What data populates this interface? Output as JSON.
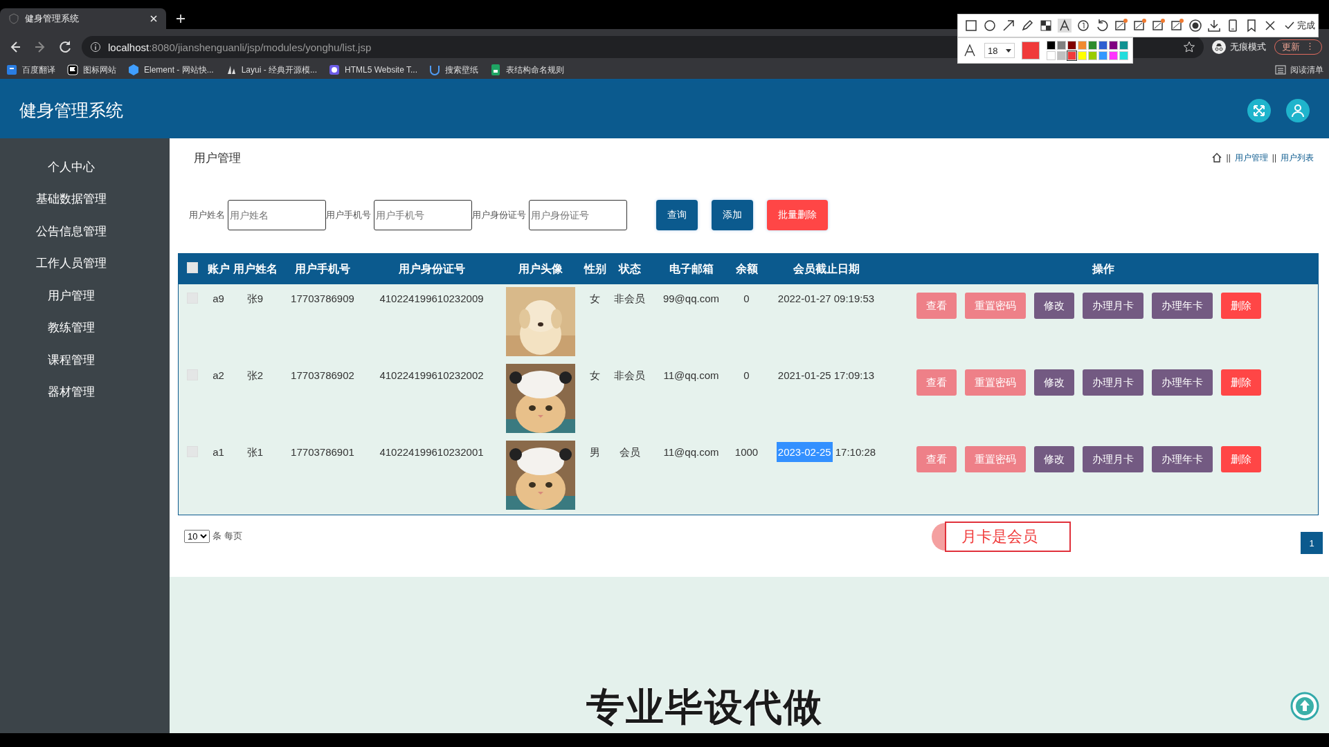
{
  "browser": {
    "tab_title": "健身管理系统",
    "url_host": "localhost",
    "url_path": ":8080/jianshenguanli/jsp/modules/yonghu/list.jsp",
    "incognito": "无痕模式",
    "update": "更新",
    "update_menu": "⋮",
    "reading_list": "阅读清单",
    "bookmarks": [
      {
        "label": "百度翻译",
        "kind": "translate"
      },
      {
        "label": "图标网站",
        "kind": "flag"
      },
      {
        "label": "Element - 网站快...",
        "kind": "hex"
      },
      {
        "label": "Layui - 经典开源模...",
        "kind": "layui"
      },
      {
        "label": "HTML5 Website T...",
        "kind": "mask"
      },
      {
        "label": "搜索壁纸",
        "kind": "u"
      },
      {
        "label": "表结构命名规则",
        "kind": "sheet"
      }
    ]
  },
  "snip_toolbar": {
    "done": "完成",
    "font_size": "18",
    "palette": [
      {
        "color": "#000000",
        "selected": false
      },
      {
        "color": "#808080",
        "selected": false
      },
      {
        "color": "#800000",
        "selected": false
      },
      {
        "color": "#f08a30",
        "selected": false
      },
      {
        "color": "#2e8b2e",
        "selected": false
      },
      {
        "color": "#2f5fd0",
        "selected": false
      },
      {
        "color": "#800080",
        "selected": false
      },
      {
        "color": "#109090",
        "selected": false
      },
      {
        "color": "#ffffff",
        "selected": false
      },
      {
        "color": "#c0c0c0",
        "selected": false
      },
      {
        "color": "#f03a3a",
        "selected": true
      },
      {
        "color": "#ffff00",
        "selected": false
      },
      {
        "color": "#99cc00",
        "selected": false
      },
      {
        "color": "#3399ff",
        "selected": false
      },
      {
        "color": "#ff33ff",
        "selected": false
      },
      {
        "color": "#22dddd",
        "selected": false
      }
    ]
  },
  "app": {
    "title": "健身管理系统"
  },
  "sidebar": {
    "items": [
      {
        "label": "个人中心"
      },
      {
        "label": "基础数据管理"
      },
      {
        "label": "公告信息管理"
      },
      {
        "label": "工作人员管理"
      },
      {
        "label": "用户管理"
      },
      {
        "label": "教练管理"
      },
      {
        "label": "课程管理"
      },
      {
        "label": "器材管理"
      }
    ]
  },
  "page": {
    "title": "用户管理",
    "breadcrumb": [
      {
        "separator": "||",
        "label": "用户管理"
      },
      {
        "separator": "||",
        "label": "用户列表"
      }
    ]
  },
  "filters": [
    {
      "label": "用户姓名",
      "placeholder": "用户姓名"
    },
    {
      "label": "用户手机号",
      "placeholder": "用户手机号"
    },
    {
      "label": "用户身份证号",
      "placeholder": "用户身份证号"
    }
  ],
  "buttons": [
    {
      "label": "查询",
      "kind": "primary"
    },
    {
      "label": "添加",
      "kind": "primary"
    },
    {
      "label": "批量删除",
      "kind": "danger"
    }
  ],
  "table": {
    "all_checked": false,
    "columns": [
      "账户",
      "用户姓名",
      "用户手机号",
      "用户身份证号",
      "用户头像",
      "性别",
      "状态",
      "电子邮箱",
      "余额",
      "会员截止日期",
      "操作"
    ],
    "rows": [
      {
        "checked": false,
        "account": "a9",
        "name": "张9",
        "phone": "17703786909",
        "id_number": "410224199610232009",
        "avatar": {
          "kind": "puppy"
        },
        "gender": "女",
        "status": "非会员",
        "email": "99@qq.com",
        "balance": "0",
        "expiry_date": "2022-01-27",
        "expiry_time": "09:19:53",
        "date_highlighted": false,
        "actions": [
          {
            "label": "查看",
            "kind": "light"
          },
          {
            "label": "重置密码",
            "kind": "light"
          },
          {
            "label": "修改",
            "kind": "purple"
          },
          {
            "label": "办理月卡",
            "kind": "purple"
          },
          {
            "label": "办理年卡",
            "kind": "purple"
          },
          {
            "label": "删除",
            "kind": "danger"
          }
        ]
      },
      {
        "checked": false,
        "account": "a2",
        "name": "张2",
        "phone": "17703786902",
        "id_number": "410224199610232002",
        "avatar": {
          "kind": "cat"
        },
        "gender": "女",
        "status": "非会员",
        "email": "11@qq.com",
        "balance": "0",
        "expiry_date": "2021-01-25",
        "expiry_time": "17:09:13",
        "date_highlighted": false,
        "actions": [
          {
            "label": "查看",
            "kind": "light"
          },
          {
            "label": "重置密码",
            "kind": "light"
          },
          {
            "label": "修改",
            "kind": "purple"
          },
          {
            "label": "办理月卡",
            "kind": "purple"
          },
          {
            "label": "办理年卡",
            "kind": "purple"
          },
          {
            "label": "删除",
            "kind": "danger"
          }
        ]
      },
      {
        "checked": false,
        "account": "a1",
        "name": "张1",
        "phone": "17703786901",
        "id_number": "410224199610232001",
        "avatar": {
          "kind": "cat"
        },
        "gender": "男",
        "status": "会员",
        "email": "11@qq.com",
        "balance": "1000",
        "expiry_date": "2023-02-25",
        "expiry_time": "17:10:28",
        "date_highlighted": true,
        "actions": [
          {
            "label": "查看",
            "kind": "light"
          },
          {
            "label": "重置密码",
            "kind": "light"
          },
          {
            "label": "修改",
            "kind": "purple"
          },
          {
            "label": "办理月卡",
            "kind": "purple"
          },
          {
            "label": "办理年卡",
            "kind": "purple"
          },
          {
            "label": "删除",
            "kind": "danger"
          }
        ]
      }
    ]
  },
  "pagination": {
    "page_size": "10",
    "page_size_suffix": "条 每页",
    "pages": [
      {
        "label": "1",
        "selected": true
      }
    ]
  },
  "annotation": {
    "text": "月卡是会员"
  },
  "caption": "专业毕设代做"
}
